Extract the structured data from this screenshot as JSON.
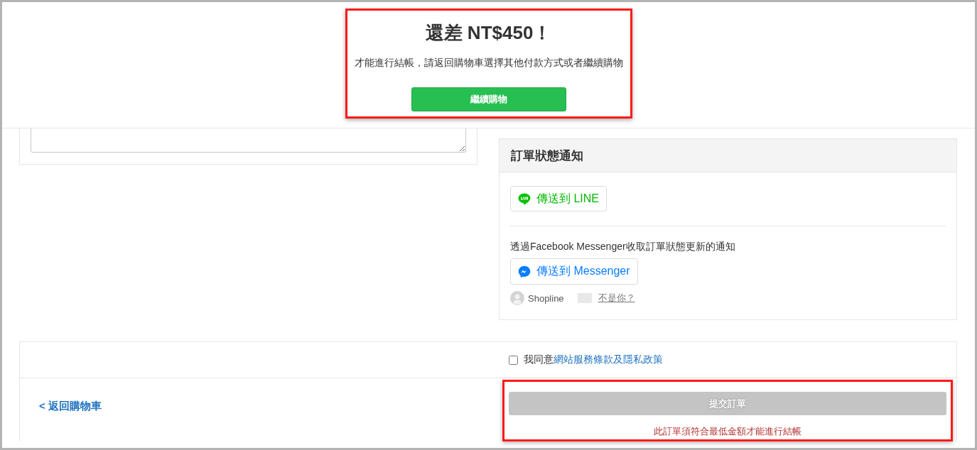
{
  "banner": {
    "title": "還差 NT$450！",
    "message": "才能進行結帳，請返回購物車選擇其他付款方式或者繼續購物",
    "button": "繼續購物"
  },
  "notifications": {
    "title": "訂單狀態通知",
    "line_button": "傳送到 LINE",
    "messenger_hint": "透過Facebook Messenger收取訂單狀態更新的通知",
    "messenger_button": "傳送到 Messenger",
    "account": {
      "name": "Shopline",
      "switch_link": "不是你？"
    }
  },
  "agreement": {
    "checked": false,
    "text": "我同意",
    "link": "網站服務條款及隱私政策"
  },
  "back_link": "< 返回購物車",
  "submit": {
    "label": "提交訂單",
    "disabled": true
  },
  "error": "此訂單須符合最低金額才能進行結帳"
}
